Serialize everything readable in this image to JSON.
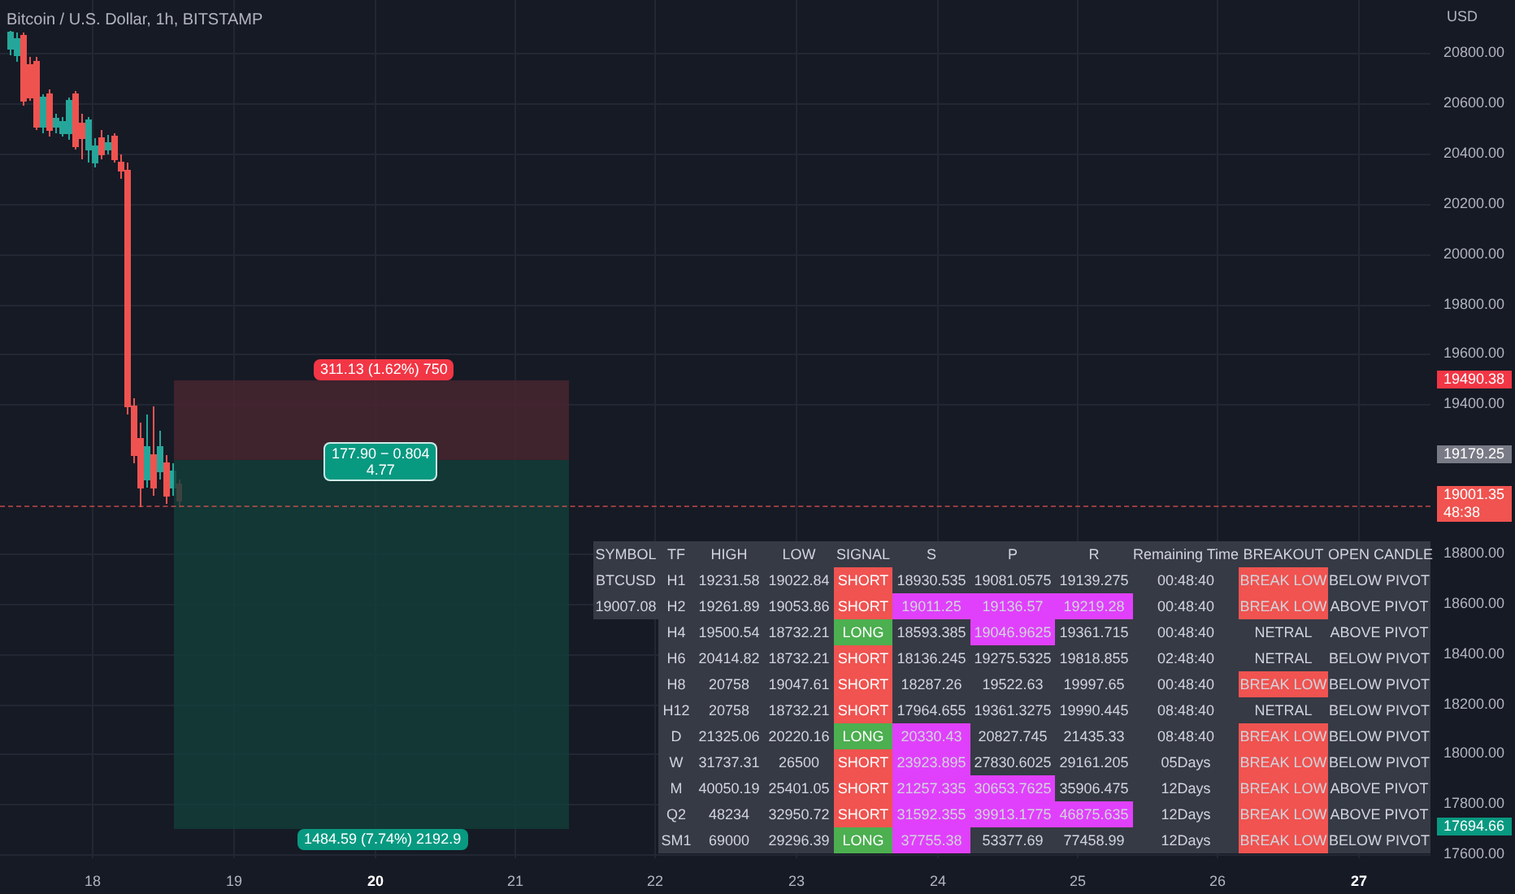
{
  "chart": {
    "title": "Bitcoin / U.S. Dollar, 1h, BITSTAMP",
    "position": {
      "target_label": "311.13 (1.62%) 750",
      "center_label": [
        "177.90 − 0.804",
        "4.77"
      ],
      "stop_label": "1484.59 (7.74%) 2192.9"
    }
  },
  "price_axis": {
    "currency": "USD",
    "labels": [
      "20800.00",
      "20600.00",
      "20400.00",
      "20200.00",
      "20000.00",
      "19800.00",
      "19600.00",
      "19400.00",
      "18800.00",
      "18600.00",
      "18400.00",
      "18200.00",
      "18000.00",
      "17800.00",
      "17600.00"
    ],
    "markers": [
      {
        "lines": [
          "19490.38"
        ],
        "color": "#f23645"
      },
      {
        "lines": [
          "19179.25"
        ],
        "color": "#787b86"
      },
      {
        "lines": [
          "19001.35",
          "48:38"
        ],
        "color": "#f05350"
      },
      {
        "lines": [
          "17694.66"
        ],
        "color": "#089981"
      }
    ]
  },
  "time_axis": [
    {
      "label": "18",
      "major": false
    },
    {
      "label": "19",
      "major": false
    },
    {
      "label": "20",
      "major": true
    },
    {
      "label": "21",
      "major": false
    },
    {
      "label": "22",
      "major": false
    },
    {
      "label": "23",
      "major": false
    },
    {
      "label": "24",
      "major": false
    },
    {
      "label": "25",
      "major": false
    },
    {
      "label": "26",
      "major": false
    },
    {
      "label": "27",
      "major": true
    }
  ],
  "table": {
    "columns": [
      "SYMBOL",
      "TF",
      "HIGH",
      "LOW",
      "SIGNAL",
      "S",
      "P",
      "R",
      "Remaining Time",
      "BREAKOUT",
      "OPEN CANDLE"
    ],
    "rows": [
      {
        "symbol": "BTCUSD",
        "tf": "H1",
        "high": "19231.58",
        "low": "19022.84",
        "signal": {
          "text": "SHORT",
          "color": "#f05350"
        },
        "s": {
          "text": "18930.535",
          "highlighted": false
        },
        "p": {
          "text": "19081.0575",
          "highlighted": false
        },
        "r": {
          "text": "19139.275",
          "highlighted": false
        },
        "remaining": "00:48:40",
        "breakout": {
          "text": "BREAK LOW",
          "highlighted": true
        },
        "open_candle": "BELOW PIVOT"
      },
      {
        "symbol": "19007.08",
        "tf": "H2",
        "high": "19261.89",
        "low": "19053.86",
        "signal": {
          "text": "SHORT",
          "color": "#f05350"
        },
        "s": {
          "text": "19011.25",
          "highlighted": true
        },
        "p": {
          "text": "19136.57",
          "highlighted": true
        },
        "r": {
          "text": "19219.28",
          "highlighted": true
        },
        "remaining": "00:48:40",
        "breakout": {
          "text": "BREAK LOW",
          "highlighted": true
        },
        "open_candle": "ABOVE PIVOT"
      },
      {
        "tf": "H4",
        "high": "19500.54",
        "low": "18732.21",
        "signal": {
          "text": "LONG",
          "color": "#4caf50"
        },
        "s": {
          "text": "18593.385",
          "highlighted": false
        },
        "p": {
          "text": "19046.9625",
          "highlighted": true
        },
        "r": {
          "text": "19361.715",
          "highlighted": false
        },
        "remaining": "00:48:40",
        "breakout": {
          "text": "NETRAL",
          "highlighted": false
        },
        "open_candle": "ABOVE PIVOT"
      },
      {
        "tf": "H6",
        "high": "20414.82",
        "low": "18732.21",
        "signal": {
          "text": "SHORT",
          "color": "#f05350"
        },
        "s": {
          "text": "18136.245",
          "highlighted": false
        },
        "p": {
          "text": "19275.5325",
          "highlighted": false
        },
        "r": {
          "text": "19818.855",
          "highlighted": false
        },
        "remaining": "02:48:40",
        "breakout": {
          "text": "NETRAL",
          "highlighted": false
        },
        "open_candle": "BELOW PIVOT"
      },
      {
        "tf": "H8",
        "high": "20758",
        "low": "19047.61",
        "signal": {
          "text": "SHORT",
          "color": "#f05350"
        },
        "s": {
          "text": "18287.26",
          "highlighted": false
        },
        "p": {
          "text": "19522.63",
          "highlighted": false
        },
        "r": {
          "text": "19997.65",
          "highlighted": false
        },
        "remaining": "00:48:40",
        "breakout": {
          "text": "BREAK LOW",
          "highlighted": true
        },
        "open_candle": "BELOW PIVOT"
      },
      {
        "tf": "H12",
        "high": "20758",
        "low": "18732.21",
        "signal": {
          "text": "SHORT",
          "color": "#f05350"
        },
        "s": {
          "text": "17964.655",
          "highlighted": false
        },
        "p": {
          "text": "19361.3275",
          "highlighted": false
        },
        "r": {
          "text": "19990.445",
          "highlighted": false
        },
        "remaining": "08:48:40",
        "breakout": {
          "text": "NETRAL",
          "highlighted": false
        },
        "open_candle": "BELOW PIVOT"
      },
      {
        "tf": "D",
        "high": "21325.06",
        "low": "20220.16",
        "signal": {
          "text": "LONG",
          "color": "#4caf50"
        },
        "s": {
          "text": "20330.43",
          "highlighted": true
        },
        "p": {
          "text": "20827.745",
          "highlighted": false
        },
        "r": {
          "text": "21435.33",
          "highlighted": false
        },
        "remaining": "08:48:40",
        "breakout": {
          "text": "BREAK LOW",
          "highlighted": true
        },
        "open_candle": "BELOW PIVOT"
      },
      {
        "tf": "W",
        "high": "31737.31",
        "low": "26500",
        "signal": {
          "text": "SHORT",
          "color": "#f05350"
        },
        "s": {
          "text": "23923.895",
          "highlighted": true
        },
        "p": {
          "text": "27830.6025",
          "highlighted": false
        },
        "r": {
          "text": "29161.205",
          "highlighted": false
        },
        "remaining": "05Days",
        "breakout": {
          "text": "BREAK LOW",
          "highlighted": true
        },
        "open_candle": "BELOW PIVOT"
      },
      {
        "tf": "M",
        "high": "40050.19",
        "low": "25401.05",
        "signal": {
          "text": "SHORT",
          "color": "#f05350"
        },
        "s": {
          "text": "21257.335",
          "highlighted": true
        },
        "p": {
          "text": "30653.7625",
          "highlighted": true
        },
        "r": {
          "text": "35906.475",
          "highlighted": false
        },
        "remaining": "12Days",
        "breakout": {
          "text": "BREAK LOW",
          "highlighted": true
        },
        "open_candle": "ABOVE PIVOT"
      },
      {
        "tf": "Q2",
        "high": "48234",
        "low": "32950.72",
        "signal": {
          "text": "SHORT",
          "color": "#f05350"
        },
        "s": {
          "text": "31592.355",
          "highlighted": true
        },
        "p": {
          "text": "39913.1775",
          "highlighted": true
        },
        "r": {
          "text": "46875.635",
          "highlighted": true
        },
        "remaining": "12Days",
        "breakout": {
          "text": "BREAK LOW",
          "highlighted": true
        },
        "open_candle": "ABOVE PIVOT"
      },
      {
        "tf": "SM1",
        "high": "69000",
        "low": "29296.39",
        "signal": {
          "text": "LONG",
          "color": "#4caf50"
        },
        "s": {
          "text": "37755.38",
          "highlighted": true
        },
        "p": {
          "text": "53377.69",
          "highlighted": false
        },
        "r": {
          "text": "77458.99",
          "highlighted": false
        },
        "remaining": "12Days",
        "breakout": {
          "text": "BREAK LOW",
          "highlighted": true
        },
        "open_candle": "BELOW PIVOT"
      }
    ]
  }
}
